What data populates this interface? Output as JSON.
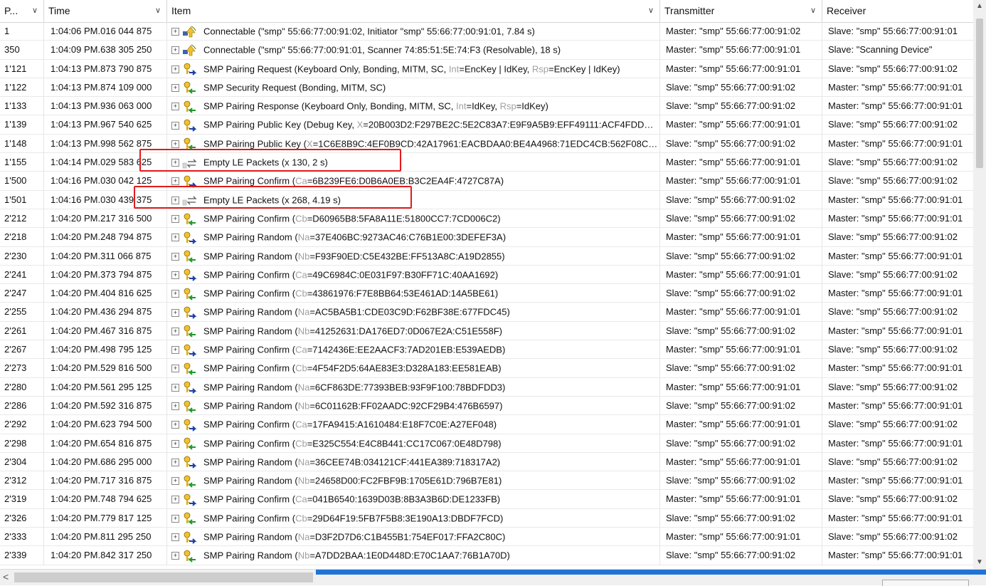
{
  "columns": [
    {
      "label": "P...",
      "key": "p"
    },
    {
      "label": "Time",
      "key": "t"
    },
    {
      "label": "Item",
      "key": "i"
    },
    {
      "label": "Transmitter",
      "key": "tr"
    },
    {
      "label": "Receiver",
      "key": "r"
    }
  ],
  "rows": [
    {
      "p": "1",
      "t": "1:04:06 PM.016 044 875",
      "icon": "connect-icon",
      "item": [
        {
          "s": "Connectable (\"smp\" 55:66:77:00:91:02, Initiator \"smp\" 55:66:77:00:91:01, 7.84 s)"
        }
      ],
      "tr": "Master: \"smp\" 55:66:77:00:91:02",
      "r": "Slave: \"smp\" 55:66:77:00:91:01"
    },
    {
      "p": "350",
      "t": "1:04:09 PM.638 305 250",
      "icon": "connect-icon",
      "item": [
        {
          "s": "Connectable (\"smp\" 55:66:77:00:91:01, Scanner 74:85:51:5E:74:F3 (Resolvable), 18 s)"
        }
      ],
      "tr": "Master: \"smp\" 55:66:77:00:91:01",
      "r": "Slave: \"Scanning Device\""
    },
    {
      "p": "1'121",
      "t": "1:04:13 PM.873 790 875",
      "icon": "key-blue-icon",
      "item": [
        {
          "s": "SMP Pairing Request (Keyboard Only, Bonding, MITM, SC, "
        },
        {
          "s": "Int",
          "f": 1
        },
        {
          "s": "=EncKey | IdKey, "
        },
        {
          "s": "Rsp",
          "f": 1
        },
        {
          "s": "=EncKey | IdKey)"
        }
      ],
      "tr": "Master: \"smp\" 55:66:77:00:91:01",
      "r": "Slave: \"smp\" 55:66:77:00:91:02"
    },
    {
      "p": "1'122",
      "t": "1:04:13 PM.874 109 000",
      "icon": "key-green-icon",
      "item": [
        {
          "s": "SMP Security Request (Bonding, MITM, SC)"
        }
      ],
      "tr": "Slave: \"smp\" 55:66:77:00:91:02",
      "r": "Master: \"smp\" 55:66:77:00:91:01"
    },
    {
      "p": "1'133",
      "t": "1:04:13 PM.936 063 000",
      "icon": "key-green-icon",
      "item": [
        {
          "s": "SMP Pairing Response (Keyboard Only, Bonding, MITM, SC, "
        },
        {
          "s": "Int",
          "f": 1
        },
        {
          "s": "=IdKey, "
        },
        {
          "s": "Rsp",
          "f": 1
        },
        {
          "s": "=IdKey)"
        }
      ],
      "tr": "Slave: \"smp\" 55:66:77:00:91:02",
      "r": "Master: \"smp\" 55:66:77:00:91:01"
    },
    {
      "p": "1'139",
      "t": "1:04:13 PM.967 540 625",
      "icon": "key-blue-icon",
      "item": [
        {
          "s": "SMP Pairing Public Key (Debug Key, "
        },
        {
          "s": "X",
          "f": 1
        },
        {
          "s": "=20B003D2:F297BE2C:5E2C83A7:E9F9A5B9:EFF49111:ACF4FDD…"
        }
      ],
      "tr": "Master: \"smp\" 55:66:77:00:91:01",
      "r": "Slave: \"smp\" 55:66:77:00:91:02"
    },
    {
      "p": "1'148",
      "t": "1:04:13 PM.998 562 875",
      "icon": "key-green-icon",
      "item": [
        {
          "s": "SMP Pairing Public Key ("
        },
        {
          "s": "X",
          "f": 1
        },
        {
          "s": "=1C6E8B9C:4EF0B9CD:42A17961:EACBDAA0:BE4A4968:71EDC4CB:562F08C…"
        }
      ],
      "tr": "Slave: \"smp\" 55:66:77:00:91:02",
      "r": "Master: \"smp\" 55:66:77:00:91:01"
    },
    {
      "p": "1'155",
      "t": "1:04:14 PM.029 583 625",
      "icon": "exchange-icon",
      "item": [
        {
          "s": "Empty LE Packets (x 130, 2 s)"
        }
      ],
      "tr": "Master: \"smp\" 55:66:77:00:91:01",
      "r": "Slave: \"smp\" 55:66:77:00:91:02"
    },
    {
      "p": "1'500",
      "t": "1:04:16 PM.030 042 125",
      "icon": "key-blue-icon",
      "item": [
        {
          "s": "SMP Pairing Confirm ("
        },
        {
          "s": "Ca",
          "f": 1
        },
        {
          "s": "=6B239FE6:D0B6A0EB:B3C2EA4F:4727C87A)"
        }
      ],
      "tr": "Master: \"smp\" 55:66:77:00:91:01",
      "r": "Slave: \"smp\" 55:66:77:00:91:02"
    },
    {
      "p": "1'501",
      "t": "1:04:16 PM.030 439 375",
      "icon": "exchange-icon",
      "item": [
        {
          "s": "Empty LE Packets (x 268, 4.19 s)"
        }
      ],
      "tr": "Slave: \"smp\" 55:66:77:00:91:02",
      "r": "Master: \"smp\" 55:66:77:00:91:01"
    },
    {
      "p": "2'212",
      "t": "1:04:20 PM.217 316 500",
      "icon": "key-green-icon",
      "item": [
        {
          "s": "SMP Pairing Confirm ("
        },
        {
          "s": "Cb",
          "f": 1
        },
        {
          "s": "=D60965B8:5FA8A11E:51800CC7:7CD006C2)"
        }
      ],
      "tr": "Slave: \"smp\" 55:66:77:00:91:02",
      "r": "Master: \"smp\" 55:66:77:00:91:01"
    },
    {
      "p": "2'218",
      "t": "1:04:20 PM.248 794 875",
      "icon": "key-blue-icon",
      "item": [
        {
          "s": "SMP Pairing Random ("
        },
        {
          "s": "Na",
          "f": 1
        },
        {
          "s": "=37E406BC:9273AC46:C76B1E00:3DEFEF3A)"
        }
      ],
      "tr": "Master: \"smp\" 55:66:77:00:91:01",
      "r": "Slave: \"smp\" 55:66:77:00:91:02"
    },
    {
      "p": "2'230",
      "t": "1:04:20 PM.311 066 875",
      "icon": "key-green-icon",
      "item": [
        {
          "s": "SMP Pairing Random ("
        },
        {
          "s": "Nb",
          "f": 1
        },
        {
          "s": "=F93F90ED:C5E432BE:FF513A8C:A19D2855)"
        }
      ],
      "tr": "Slave: \"smp\" 55:66:77:00:91:02",
      "r": "Master: \"smp\" 55:66:77:00:91:01"
    },
    {
      "p": "2'241",
      "t": "1:04:20 PM.373 794 875",
      "icon": "key-blue-icon",
      "item": [
        {
          "s": "SMP Pairing Confirm ("
        },
        {
          "s": "Ca",
          "f": 1
        },
        {
          "s": "=49C6984C:0E031F97:B30FF71C:40AA1692)"
        }
      ],
      "tr": "Master: \"smp\" 55:66:77:00:91:01",
      "r": "Slave: \"smp\" 55:66:77:00:91:02"
    },
    {
      "p": "2'247",
      "t": "1:04:20 PM.404 816 625",
      "icon": "key-green-icon",
      "item": [
        {
          "s": "SMP Pairing Confirm ("
        },
        {
          "s": "Cb",
          "f": 1
        },
        {
          "s": "=43861976:F7E8BB64:53E461AD:14A5BE61)"
        }
      ],
      "tr": "Slave: \"smp\" 55:66:77:00:91:02",
      "r": "Master: \"smp\" 55:66:77:00:91:01"
    },
    {
      "p": "2'255",
      "t": "1:04:20 PM.436 294 875",
      "icon": "key-blue-icon",
      "item": [
        {
          "s": "SMP Pairing Random ("
        },
        {
          "s": "Na",
          "f": 1
        },
        {
          "s": "=AC5BA5B1:CDE03C9D:F62BF38E:677FDC45)"
        }
      ],
      "tr": "Master: \"smp\" 55:66:77:00:91:01",
      "r": "Slave: \"smp\" 55:66:77:00:91:02"
    },
    {
      "p": "2'261",
      "t": "1:04:20 PM.467 316 875",
      "icon": "key-green-icon",
      "item": [
        {
          "s": "SMP Pairing Random ("
        },
        {
          "s": "Nb",
          "f": 1
        },
        {
          "s": "=41252631:DA176ED7:0D067E2A:C51E558F)"
        }
      ],
      "tr": "Slave: \"smp\" 55:66:77:00:91:02",
      "r": "Master: \"smp\" 55:66:77:00:91:01"
    },
    {
      "p": "2'267",
      "t": "1:04:20 PM.498 795 125",
      "icon": "key-blue-icon",
      "item": [
        {
          "s": "SMP Pairing Confirm ("
        },
        {
          "s": "Ca",
          "f": 1
        },
        {
          "s": "=7142436E:EE2AACF3:7AD201EB:E539AEDB)"
        }
      ],
      "tr": "Master: \"smp\" 55:66:77:00:91:01",
      "r": "Slave: \"smp\" 55:66:77:00:91:02"
    },
    {
      "p": "2'273",
      "t": "1:04:20 PM.529 816 500",
      "icon": "key-green-icon",
      "item": [
        {
          "s": "SMP Pairing Confirm ("
        },
        {
          "s": "Cb",
          "f": 1
        },
        {
          "s": "=4F54F2D5:64AE83E3:D328A183:EE581EAB)"
        }
      ],
      "tr": "Slave: \"smp\" 55:66:77:00:91:02",
      "r": "Master: \"smp\" 55:66:77:00:91:01"
    },
    {
      "p": "2'280",
      "t": "1:04:20 PM.561 295 125",
      "icon": "key-blue-icon",
      "item": [
        {
          "s": "SMP Pairing Random ("
        },
        {
          "s": "Na",
          "f": 1
        },
        {
          "s": "=6CF863DE:77393BEB:93F9F100:78BDFDD3)"
        }
      ],
      "tr": "Master: \"smp\" 55:66:77:00:91:01",
      "r": "Slave: \"smp\" 55:66:77:00:91:02"
    },
    {
      "p": "2'286",
      "t": "1:04:20 PM.592 316 875",
      "icon": "key-green-icon",
      "item": [
        {
          "s": "SMP Pairing Random ("
        },
        {
          "s": "Nb",
          "f": 1
        },
        {
          "s": "=6C01162B:FF02AADC:92CF29B4:476B6597)"
        }
      ],
      "tr": "Slave: \"smp\" 55:66:77:00:91:02",
      "r": "Master: \"smp\" 55:66:77:00:91:01"
    },
    {
      "p": "2'292",
      "t": "1:04:20 PM.623 794 500",
      "icon": "key-blue-icon",
      "item": [
        {
          "s": "SMP Pairing Confirm ("
        },
        {
          "s": "Ca",
          "f": 1
        },
        {
          "s": "=17FA9415:A1610484:E18F7C0E:A27EF048)"
        }
      ],
      "tr": "Master: \"smp\" 55:66:77:00:91:01",
      "r": "Slave: \"smp\" 55:66:77:00:91:02"
    },
    {
      "p": "2'298",
      "t": "1:04:20 PM.654 816 875",
      "icon": "key-green-icon",
      "item": [
        {
          "s": "SMP Pairing Confirm ("
        },
        {
          "s": "Cb",
          "f": 1
        },
        {
          "s": "=E325C554:E4C8B441:CC17C067:0E48D798)"
        }
      ],
      "tr": "Slave: \"smp\" 55:66:77:00:91:02",
      "r": "Master: \"smp\" 55:66:77:00:91:01"
    },
    {
      "p": "2'304",
      "t": "1:04:20 PM.686 295 000",
      "icon": "key-blue-icon",
      "item": [
        {
          "s": "SMP Pairing Random ("
        },
        {
          "s": "Na",
          "f": 1
        },
        {
          "s": "=36CEE74B:034121CF:441EA389:718317A2)"
        }
      ],
      "tr": "Master: \"smp\" 55:66:77:00:91:01",
      "r": "Slave: \"smp\" 55:66:77:00:91:02"
    },
    {
      "p": "2'312",
      "t": "1:04:20 PM.717 316 875",
      "icon": "key-green-icon",
      "item": [
        {
          "s": "SMP Pairing Random ("
        },
        {
          "s": "Nb",
          "f": 1
        },
        {
          "s": "=24658D00:FC2FBF9B:1705E61D:796B7E81)"
        }
      ],
      "tr": "Slave: \"smp\" 55:66:77:00:91:02",
      "r": "Master: \"smp\" 55:66:77:00:91:01"
    },
    {
      "p": "2'319",
      "t": "1:04:20 PM.748 794 625",
      "icon": "key-blue-icon",
      "item": [
        {
          "s": "SMP Pairing Confirm ("
        },
        {
          "s": "Ca",
          "f": 1
        },
        {
          "s": "=041B6540:1639D03B:8B3A3B6D:DE1233FB)"
        }
      ],
      "tr": "Master: \"smp\" 55:66:77:00:91:01",
      "r": "Slave: \"smp\" 55:66:77:00:91:02"
    },
    {
      "p": "2'326",
      "t": "1:04:20 PM.779 817 125",
      "icon": "key-green-icon",
      "item": [
        {
          "s": "SMP Pairing Confirm ("
        },
        {
          "s": "Cb",
          "f": 1
        },
        {
          "s": "=29D64F19:5FB7F5B8:3E190A13:DBDF7FCD)"
        }
      ],
      "tr": "Slave: \"smp\" 55:66:77:00:91:02",
      "r": "Master: \"smp\" 55:66:77:00:91:01"
    },
    {
      "p": "2'333",
      "t": "1:04:20 PM.811 295 250",
      "icon": "key-blue-icon",
      "item": [
        {
          "s": "SMP Pairing Random ("
        },
        {
          "s": "Na",
          "f": 1
        },
        {
          "s": "=D3F2D7D6:C1B455B1:754EF017:FFA2C80C)"
        }
      ],
      "tr": "Master: \"smp\" 55:66:77:00:91:01",
      "r": "Slave: \"smp\" 55:66:77:00:91:02"
    },
    {
      "p": "2'339",
      "t": "1:04:20 PM.842 317 250",
      "icon": "key-green-icon",
      "item": [
        {
          "s": "SMP Pairing Random ("
        },
        {
          "s": "Nb",
          "f": 1
        },
        {
          "s": "=A7DD2BAA:1E0D448D:E70C1AA7:76B1A70D)"
        }
      ],
      "tr": "Slave: \"smp\" 55:66:77:00:91:02",
      "r": "Master: \"smp\" 55:66:77:00:91:01"
    }
  ],
  "highlight_color": "#e11b1b",
  "scroll_left_arrow": "<",
  "scroll_up_arrow": "▲",
  "scroll_down_arrow": "▼",
  "expander_glyph": "⊞"
}
